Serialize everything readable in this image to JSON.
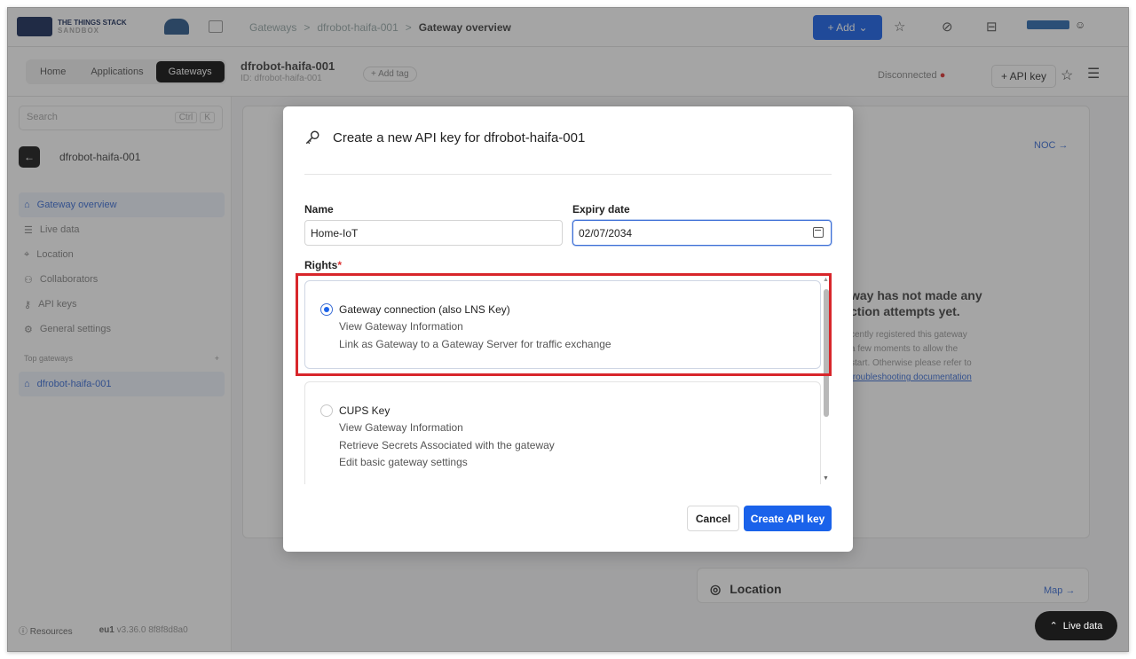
{
  "app": {
    "logo_line1": "THE THINGS STACK",
    "logo_line2": "SANDBOX"
  },
  "breadcrumb": {
    "items": [
      "Gateways",
      "dfrobot-haifa-001",
      "Gateway overview"
    ],
    "separator": ">"
  },
  "topbar": {
    "add_label": "+ Add",
    "dropdown_glyph": "⌄",
    "star_glyph": "☆",
    "tag_glyph": "⊘",
    "inbox_glyph": "⊟",
    "user_glyph": "☺"
  },
  "nav": {
    "tabs": [
      "Home",
      "Applications",
      "Gateways"
    ],
    "active_tab": "Gateways"
  },
  "gateway_header": {
    "title": "dfrobot-haifa-001",
    "subtitle": "ID: dfrobot-haifa-001",
    "add_tag": "+ Add tag",
    "status": "Disconnected",
    "status_dot": "●",
    "api_key_button": "+ API key",
    "star": "☆",
    "menu": "☰"
  },
  "sidebar": {
    "search_placeholder": "Search",
    "search_shortcut": "Ctrl",
    "search_shortcut2": "K",
    "back_label": "dfrobot-haifa-001",
    "items": [
      {
        "label": "Gateway overview",
        "icon": "⌂"
      },
      {
        "label": "Live data",
        "icon": "☰"
      },
      {
        "label": "Location",
        "icon": "⌖"
      },
      {
        "label": "Collaborators",
        "icon": "⚇"
      },
      {
        "label": "API keys",
        "icon": "⚷"
      },
      {
        "label": "General settings",
        "icon": "⚙"
      }
    ],
    "top_section": "Top gateways",
    "top_add": "+",
    "top_items": [
      {
        "label": "dfrobot-haifa-001",
        "icon": "⌂"
      }
    ],
    "footer_resources": "Resources",
    "footer_cluster": "eu1",
    "footer_version": "v3.36.0 8f8f8d8a0"
  },
  "background": {
    "noc_link": "NOC →",
    "empty_heading_1": "way has not made any",
    "empty_heading_2": "ction attempts yet.",
    "empty_text_1": "cently registered this gateway",
    "empty_text_2": "a few moments to allow the",
    "empty_text_3": "start. Otherwise please refer to",
    "empty_link": "troubleshooting documentation",
    "location_title": "Location",
    "location_link": "Map →",
    "live_data_button": "Live data"
  },
  "modal": {
    "title": "Create a new API key for dfrobot-haifa-001",
    "name_label": "Name",
    "name_value": "Home-IoT",
    "expiry_label": "Expiry date",
    "expiry_value": "02/07/2034",
    "rights_label": "Rights",
    "rights_required": "*",
    "rights": [
      {
        "title": "Gateway connection (also LNS Key)",
        "selected": true,
        "items": [
          "View Gateway Information",
          "Link as Gateway to a Gateway Server for traffic exchange"
        ]
      },
      {
        "title": "CUPS Key",
        "selected": false,
        "items": [
          "View Gateway Information",
          "Retrieve Secrets Associated with the gateway",
          "Edit basic gateway settings"
        ]
      }
    ],
    "cancel_label": "Cancel",
    "create_label": "Create API key"
  },
  "colors": {
    "primary": "#1a62ea",
    "highlight": "#d8262b",
    "overlay": "rgba(40,40,40,.42)"
  }
}
